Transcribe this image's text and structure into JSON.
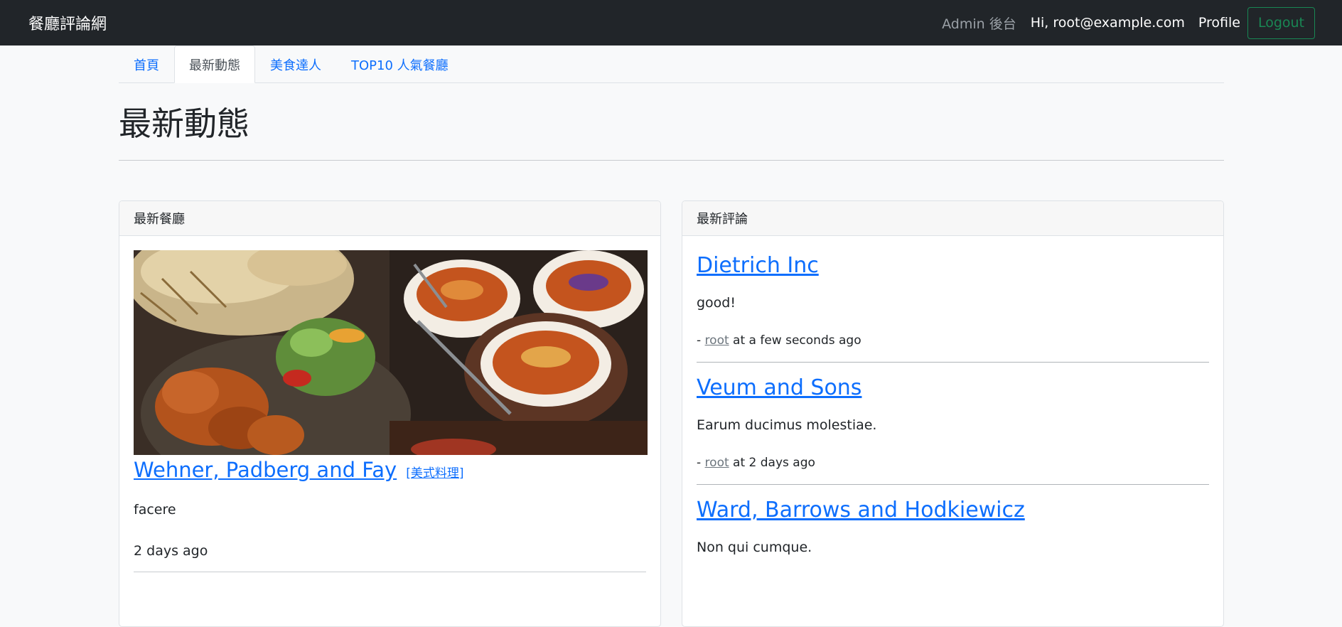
{
  "navbar": {
    "brand": "餐廳評論網",
    "admin": "Admin 後台",
    "greeting": "Hi, root@example.com",
    "profile": "Profile",
    "logout": "Logout"
  },
  "tabs": [
    {
      "label": "首頁",
      "active": false
    },
    {
      "label": "最新動態",
      "active": true
    },
    {
      "label": "美食達人",
      "active": false
    },
    {
      "label": "TOP10 人氣餐廳",
      "active": false
    }
  ],
  "page": {
    "title": "最新動態"
  },
  "restaurants_card": {
    "header": "最新餐廳",
    "items": [
      {
        "name": "Wehner, Padberg and Fay",
        "category": "[美式料理]",
        "description": "facere",
        "time": "2 days ago"
      }
    ]
  },
  "reviews_card": {
    "header": "最新評論",
    "items": [
      {
        "restaurant": "Dietrich Inc",
        "text": "good!",
        "prefix": "- ",
        "user": "root",
        "time": " at a few seconds ago"
      },
      {
        "restaurant": "Veum and Sons",
        "text": "Earum ducimus molestiae.",
        "prefix": "- ",
        "user": "root",
        "time": " at 2 days ago"
      },
      {
        "restaurant": "Ward, Barrows and Hodkiewicz",
        "text": "Non qui cumque.",
        "prefix": "",
        "user": "",
        "time": ""
      }
    ]
  },
  "colors": {
    "navbar_bg": "#212529",
    "link": "#0d6efd",
    "logout": "#198754"
  }
}
